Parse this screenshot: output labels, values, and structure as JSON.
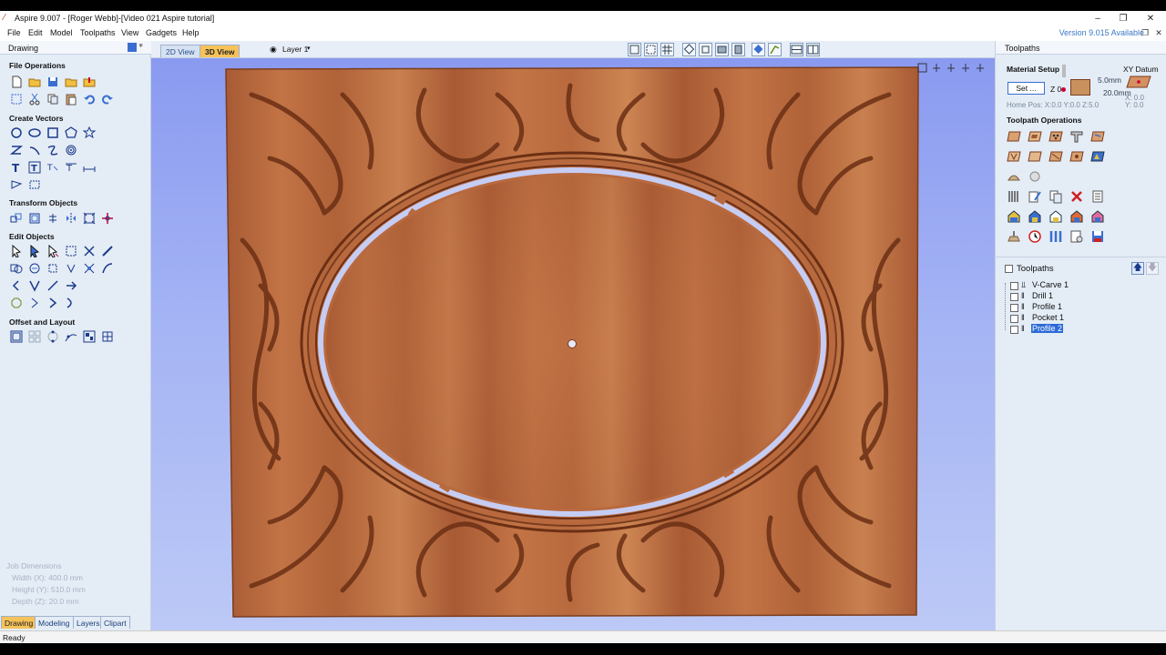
{
  "window": {
    "title": "Aspire 9.007 - [Roger Webb]-[Video 021 Aspire tutorial]",
    "controls": [
      "–",
      "❐",
      "✕"
    ]
  },
  "menu": {
    "items": [
      "File",
      "Edit",
      "Model",
      "Toolpaths",
      "View",
      "Gadgets",
      "Help"
    ],
    "version_notice": "Version 9.015 Available"
  },
  "left_panel": {
    "header": "Drawing",
    "sections": {
      "file_operations": "File Operations",
      "create_vectors": "Create Vectors",
      "transform_objects": "Transform Objects",
      "edit_objects": "Edit Objects",
      "offset_layout": "Offset and Layout"
    },
    "job_dimensions": {
      "title": "Job Dimensions",
      "width": "Width  (X): 400.0 mm",
      "height": "Height (Y): 510.0 mm",
      "depth": "Depth  (Z): 20.0 mm"
    },
    "tabs": [
      "Drawing",
      "Modeling",
      "Layers",
      "Clipart"
    ]
  },
  "view_bar": {
    "tabs": [
      "2D View",
      "3D View"
    ],
    "layer_select": "Layer 1"
  },
  "right_panel": {
    "header": "Toolpaths",
    "material_setup": {
      "title": "Material Setup",
      "set_button": "Set ...",
      "z_zero": "Z 0",
      "thickness_top": "5.0mm",
      "thickness_total": "20.0mm",
      "home_pos": "Home Pos:  X:0.0 Y:0.0 Z:5.0",
      "xy_datum": "XY Datum",
      "x0": "X: 0.0",
      "y0": "Y: 0.0"
    },
    "toolpath_operations": "Toolpath Operations",
    "toolpaths_list_title": "Toolpaths",
    "toolpaths": [
      {
        "name": "V-Carve 1",
        "selected": false
      },
      {
        "name": "Drill 1",
        "selected": false
      },
      {
        "name": "Profile 1",
        "selected": false
      },
      {
        "name": "Pocket 1",
        "selected": false
      },
      {
        "name": "Profile 2",
        "selected": true
      }
    ]
  },
  "status": {
    "text": "Ready"
  },
  "colors": {
    "accent_tab": "#f6c25a",
    "wood": "#b8683e",
    "viewport_bg": "#9aaaf2",
    "version_link": "#3a78c8"
  }
}
